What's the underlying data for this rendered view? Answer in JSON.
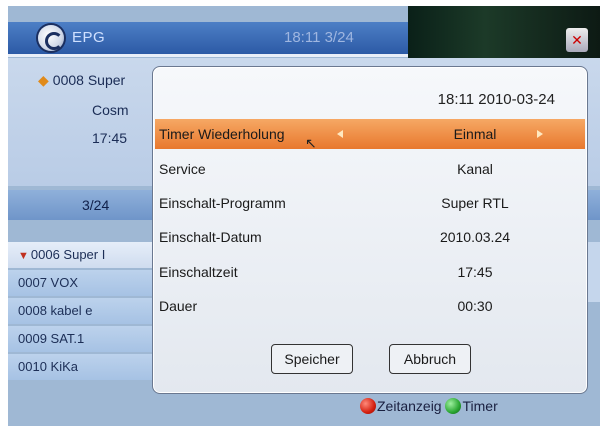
{
  "header": {
    "title": "EPG",
    "time": "18:11 3/24"
  },
  "info": {
    "channel_line": "0008 Super",
    "title_fragment": "Cosm",
    "time_fragment": "17:45"
  },
  "page_indicator": "3/24",
  "channels": [
    {
      "label": "0006 Super I",
      "selected": true
    },
    {
      "label": "0007 VOX"
    },
    {
      "label": "0008 kabel e"
    },
    {
      "label": "0009 SAT.1"
    },
    {
      "label": "0010 KiKa"
    }
  ],
  "popup": {
    "datetime": "18:11 2010-03-24",
    "rows": [
      {
        "label": "Timer Wiederholung",
        "value": "Einmal",
        "highlighted": true
      },
      {
        "label": "Service",
        "value": "Kanal"
      },
      {
        "label": "Einschalt-Programm",
        "value": "Super RTL"
      },
      {
        "label": "Einschalt-Datum",
        "value": "2010.03.24"
      },
      {
        "label": "Einschaltzeit",
        "value": "17:45"
      },
      {
        "label": "Dauer",
        "value": "00:30"
      }
    ],
    "save_label": "Speicher",
    "cancel_label": "Abbruch"
  },
  "legend": {
    "red_label": "Zeitanzeig",
    "green_label": "Timer"
  },
  "colors": {
    "highlight": "#e8782e",
    "header": "#2c5aa6"
  },
  "icons": [
    "epg-logo-icon",
    "mute-icon",
    "star-icon",
    "channel-marker-icon",
    "red-key-icon",
    "green-key-icon",
    "arrow-left-icon",
    "arrow-right-icon",
    "mouse-cursor-icon"
  ]
}
